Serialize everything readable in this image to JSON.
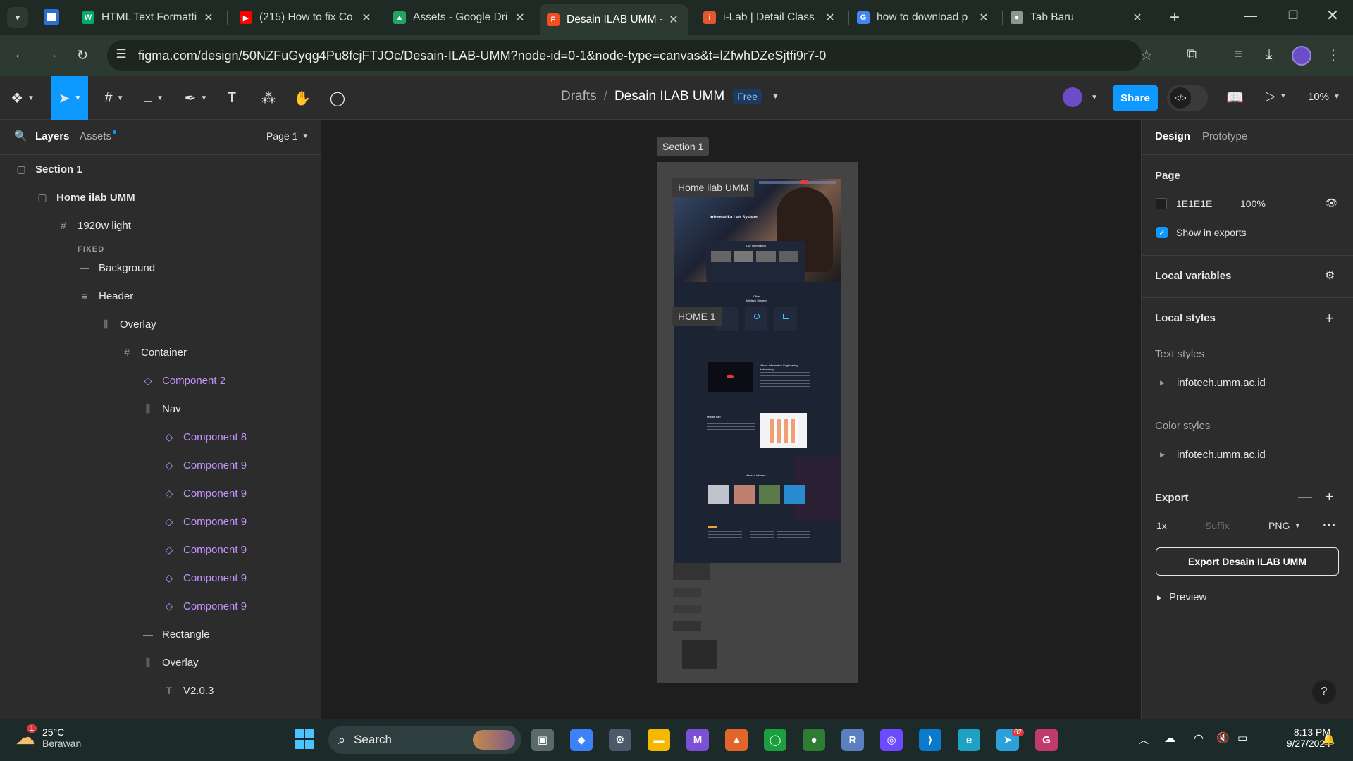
{
  "browser": {
    "tabs": [
      {
        "title": "HTML Text Formatti",
        "favicon": "w3schools-icon",
        "color": "#04aa6d",
        "letter": "W"
      },
      {
        "title": "(215) How to fix Co",
        "favicon": "youtube-icon",
        "color": "#ff0000",
        "letter": "▶"
      },
      {
        "title": "Assets - Google Dri",
        "favicon": "google-drive-icon",
        "color": "#1fa463",
        "letter": "▲"
      },
      {
        "title": "Desain ILAB UMM -",
        "favicon": "figma-icon",
        "color": "#f24e1e",
        "letter": "F"
      },
      {
        "title": "i-Lab | Detail Class",
        "favicon": "ilab-icon",
        "color": "#e4572e",
        "letter": "i"
      },
      {
        "title": "how to download p",
        "favicon": "google-icon",
        "color": "#4285f4",
        "letter": "G"
      },
      {
        "title": "Tab Baru",
        "favicon": "chrome-icon",
        "color": "#8a9a90",
        "letter": "●"
      }
    ],
    "url": "figma.com/design/50NZFuGyqg4Pu8fcjFTJOc/Desain-ILAB-UMM?node-id=0-1&node-type=canvas&t=lZfwhDZeSjtfi9r7-0"
  },
  "toolbar": {
    "breadcrumb_drafts": "Drafts",
    "breadcrumb_sep": "/",
    "file_name": "Desain ILAB UMM",
    "plan_badge": "Free",
    "share_label": "Share",
    "zoom": "10%"
  },
  "left_panel": {
    "tab_layers": "Layers",
    "tab_assets": "Assets",
    "page_select": "Page 1",
    "fixed_label": "FIXED",
    "layers": [
      {
        "name": "Section 1",
        "icon": "section-icon",
        "indent": 0,
        "kind": "section"
      },
      {
        "name": "Home ilab UMM",
        "icon": "section-icon",
        "indent": 1,
        "kind": "section"
      },
      {
        "name": "1920w light",
        "icon": "frame-icon",
        "indent": 2,
        "kind": "frame"
      },
      {
        "name": "Background",
        "icon": "line-icon",
        "indent": 3,
        "kind": "shape"
      },
      {
        "name": "Header",
        "icon": "text-lines-icon",
        "indent": 3,
        "kind": "frame"
      },
      {
        "name": "Overlay",
        "icon": "autolayout-icon",
        "indent": 4,
        "kind": "frame"
      },
      {
        "name": "Container",
        "icon": "frame-icon",
        "indent": 5,
        "kind": "frame"
      },
      {
        "name": "Component 2",
        "icon": "component-icon",
        "indent": 6,
        "kind": "component"
      },
      {
        "name": "Nav",
        "icon": "autolayout-icon",
        "indent": 6,
        "kind": "frame"
      },
      {
        "name": "Component 8",
        "icon": "component-icon",
        "indent": 7,
        "kind": "component"
      },
      {
        "name": "Component 9",
        "icon": "component-icon",
        "indent": 7,
        "kind": "component"
      },
      {
        "name": "Component 9",
        "icon": "component-icon",
        "indent": 7,
        "kind": "component"
      },
      {
        "name": "Component 9",
        "icon": "component-icon",
        "indent": 7,
        "kind": "component"
      },
      {
        "name": "Component 9",
        "icon": "component-icon",
        "indent": 7,
        "kind": "component"
      },
      {
        "name": "Component 9",
        "icon": "component-icon",
        "indent": 7,
        "kind": "component"
      },
      {
        "name": "Component 9",
        "icon": "component-icon",
        "indent": 7,
        "kind": "component"
      },
      {
        "name": "Rectangle",
        "icon": "line-icon",
        "indent": 6,
        "kind": "shape"
      },
      {
        "name": "Overlay",
        "icon": "autolayout-icon",
        "indent": 6,
        "kind": "frame"
      },
      {
        "name": "V2.0.3",
        "icon": "text-icon",
        "indent": 7,
        "kind": "text"
      }
    ]
  },
  "canvas": {
    "section_label": "Section 1",
    "frame_label": "Home ilab UMM",
    "frame2_label": "HOME 1",
    "preview_texts": {
      "hero": "Informatika Lab System",
      "info": "Our Information",
      "other": "Other",
      "other2": "Infotech System",
      "about": "About Informatics Engineering Laboratory",
      "mobile": "Mobile Lab",
      "area": "Area of Interest"
    }
  },
  "right_panel": {
    "tab_design": "Design",
    "tab_prototype": "Prototype",
    "page_heading": "Page",
    "page_color_hex": "1E1E1E",
    "page_color": "#1e1e1e",
    "page_opacity": "100%",
    "show_in_exports": "Show in exports",
    "local_variables": "Local variables",
    "local_styles": "Local styles",
    "text_styles": "Text styles",
    "text_style_item": "infotech.umm.ac.id",
    "color_styles": "Color styles",
    "color_style_item": "infotech.umm.ac.id",
    "export_heading": "Export",
    "export_scale": "1x",
    "export_suffix_placeholder": "Suffix",
    "export_format": "PNG",
    "export_button": "Export Desain ILAB UMM",
    "preview": "Preview"
  },
  "taskbar": {
    "weather_temp": "25°C",
    "weather_desc": "Berawan",
    "weather_badge": "1",
    "search_label": "Search",
    "time": "8:13 PM",
    "date": "9/27/2024",
    "telegram_badge": "62",
    "apps": [
      {
        "name": "task-view-icon",
        "color": "#5b6b6b",
        "letter": "▣"
      },
      {
        "name": "copilot-icon",
        "color": "#3b82f6",
        "letter": "◆"
      },
      {
        "name": "settings-icon",
        "color": "#4a5a6a",
        "letter": "⚙"
      },
      {
        "name": "file-explorer-icon",
        "color": "#f5b800",
        "letter": "▬"
      },
      {
        "name": "visual-studio-icon",
        "color": "#7b4fd6",
        "letter": "M"
      },
      {
        "name": "matlab-icon",
        "color": "#e2662b",
        "letter": "▲"
      },
      {
        "name": "circle-app-icon",
        "color": "#1b9e3e",
        "letter": "◯"
      },
      {
        "name": "chrome-icon",
        "color": "#2e7d32",
        "letter": "●"
      },
      {
        "name": "r-lang-icon",
        "color": "#5b7fbf",
        "letter": "R"
      },
      {
        "name": "proton-icon",
        "color": "#6d4aff",
        "letter": "◎"
      },
      {
        "name": "vscode-icon",
        "color": "#0a7acc",
        "letter": "⟩"
      },
      {
        "name": "edge-icon",
        "color": "#1da1c4",
        "letter": "e"
      },
      {
        "name": "telegram-icon",
        "color": "#2aa1da",
        "letter": "➤"
      },
      {
        "name": "pdf-app-icon",
        "color": "#c03a6b",
        "letter": "G"
      }
    ]
  }
}
